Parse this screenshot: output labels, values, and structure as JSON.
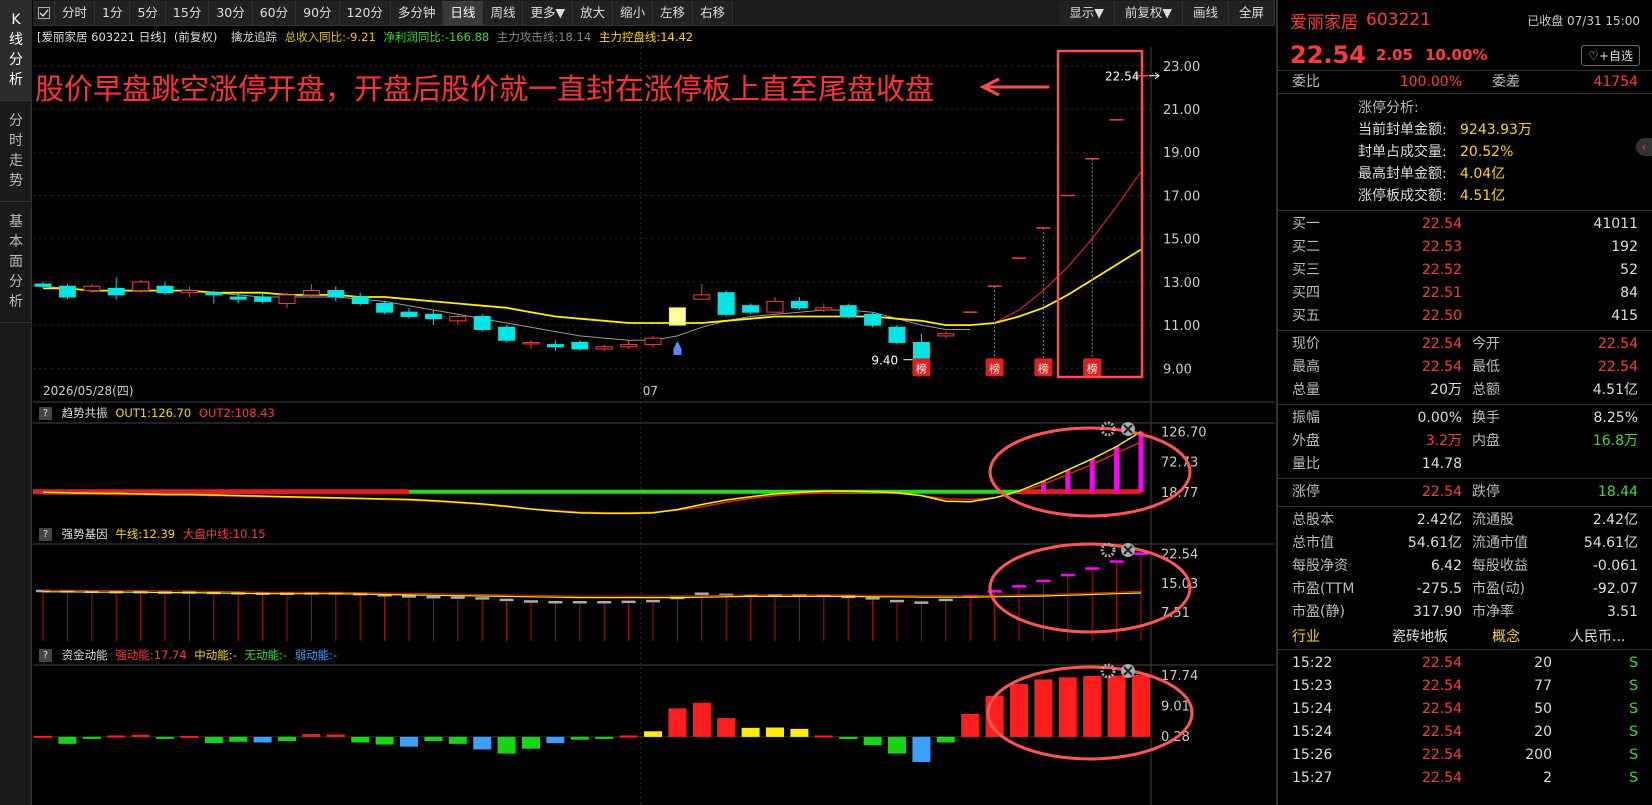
{
  "rail": [
    {
      "chars": [
        "K",
        "线",
        "分",
        "析"
      ],
      "active": true
    },
    {
      "chars": [
        "分",
        "时",
        "走",
        "势"
      ],
      "active": false
    },
    {
      "chars": [
        "基",
        "本",
        "面",
        "分",
        "析"
      ],
      "active": false
    }
  ],
  "toolbar": {
    "periods": [
      "分时",
      "1分",
      "5分",
      "15分",
      "30分",
      "60分",
      "90分",
      "120分",
      "多分钟",
      "日线",
      "周线",
      "更多▼"
    ],
    "active_period": "日线",
    "actions": [
      "放大",
      "缩小",
      "左移",
      "右移"
    ],
    "right": [
      "显示▼",
      "前复权▼",
      "画线",
      "全屏"
    ]
  },
  "main_info": {
    "stock": "[爱丽家居 603221 日线]",
    "adj": "(前复权)",
    "indicator": "擒龙追踪",
    "rev_label": "总收入同比:",
    "rev_value": "-9.21",
    "profit_label": "净利润同比:",
    "profit_value": "-166.88",
    "attack_label": "主力攻击线:",
    "attack_value": "18.14",
    "control_label": "主力控盘线:",
    "control_value": "14.42"
  },
  "annotation": "股价早盘跳空涨停开盘，开盘后股价就一直封在涨停板上直至尾盘收盘",
  "chart_data": [
    {
      "type": "candlestick",
      "date_label": "2026/05/28(四)",
      "mid_label": "07",
      "y_ticks": [
        "23.00",
        "21.00",
        "19.00",
        "17.00",
        "15.00",
        "13.00",
        "11.00",
        "9.00"
      ],
      "ylim": [
        8.6,
        23.5
      ],
      "last_price_label": "22.54",
      "low_label": "9.40",
      "bang_label": "榜",
      "candles": [
        [
          12.9,
          12.8,
          13.0,
          12.7
        ],
        [
          12.8,
          12.3,
          12.9,
          12.2
        ],
        [
          12.6,
          12.8,
          12.9,
          12.5
        ],
        [
          12.7,
          12.4,
          13.2,
          12.2
        ],
        [
          12.6,
          13.0,
          13.1,
          12.5
        ],
        [
          12.8,
          12.5,
          13.0,
          12.4
        ],
        [
          12.5,
          12.6,
          12.8,
          12.3
        ],
        [
          12.5,
          12.4,
          12.6,
          12.0
        ],
        [
          12.3,
          12.2,
          12.5,
          12.0
        ],
        [
          12.3,
          12.1,
          12.5,
          12.0
        ],
        [
          12.0,
          12.4,
          12.5,
          11.8
        ],
        [
          12.4,
          12.6,
          12.9,
          12.3
        ],
        [
          12.6,
          12.3,
          12.8,
          12.1
        ],
        [
          12.3,
          12.0,
          12.5,
          11.9
        ],
        [
          12.0,
          11.6,
          12.1,
          11.5
        ],
        [
          11.6,
          11.4,
          11.8,
          11.3
        ],
        [
          11.5,
          11.3,
          11.7,
          11.0
        ],
        [
          11.2,
          11.4,
          11.5,
          11.0
        ],
        [
          11.4,
          10.8,
          11.5,
          10.7
        ],
        [
          10.9,
          10.3,
          11.0,
          10.2
        ],
        [
          10.2,
          10.2,
          10.3,
          9.9
        ],
        [
          10.1,
          10.0,
          10.3,
          9.8
        ],
        [
          10.2,
          9.9,
          10.3,
          9.8
        ],
        [
          9.9,
          10.0,
          10.1,
          9.8
        ],
        [
          10.0,
          10.1,
          10.3,
          9.9
        ],
        [
          10.1,
          10.4,
          10.5,
          10.0
        ],
        [
          11.0,
          11.8,
          11.8,
          11.0
        ],
        [
          12.2,
          12.4,
          12.9,
          12.2
        ],
        [
          12.5,
          11.5,
          12.6,
          11.4
        ],
        [
          11.9,
          11.6,
          12.0,
          11.5
        ],
        [
          11.6,
          12.1,
          12.3,
          11.6
        ],
        [
          12.1,
          11.8,
          12.3,
          11.7
        ],
        [
          11.7,
          11.8,
          12.0,
          11.6
        ],
        [
          11.9,
          11.4,
          12.0,
          11.3
        ],
        [
          11.5,
          11.0,
          11.6,
          10.9
        ],
        [
          10.9,
          10.2,
          11.0,
          10.1
        ],
        [
          10.2,
          9.4,
          10.6,
          9.4
        ],
        [
          10.5,
          10.6,
          10.7,
          10.4
        ],
        [
          11.6,
          11.6,
          11.6,
          11.6
        ],
        [
          12.8,
          12.8,
          12.8,
          12.8
        ],
        [
          14.1,
          14.1,
          14.1,
          14.1
        ],
        [
          15.5,
          15.5,
          15.5,
          15.5
        ],
        [
          17.0,
          17.0,
          17.0,
          17.0
        ],
        [
          18.7,
          18.7,
          18.7,
          18.7
        ],
        [
          20.5,
          20.5,
          20.5,
          20.5
        ],
        [
          22.54,
          22.54,
          22.54,
          22.54
        ]
      ],
      "ma_yellow": [
        12.7,
        12.7,
        12.6,
        12.6,
        12.6,
        12.6,
        12.6,
        12.5,
        12.5,
        12.5,
        12.4,
        12.4,
        12.4,
        12.3,
        12.3,
        12.2,
        12.1,
        12.0,
        11.9,
        11.8,
        11.6,
        11.4,
        11.3,
        11.2,
        11.1,
        11.1,
        11.1,
        11.1,
        11.2,
        11.3,
        11.4,
        11.4,
        11.4,
        11.4,
        11.4,
        11.3,
        11.2,
        11.0,
        11.0,
        11.1,
        11.4,
        11.8,
        12.4,
        13.1,
        13.8,
        14.5
      ],
      "ma_gray": [
        12.8,
        12.7,
        12.6,
        12.6,
        12.6,
        12.6,
        12.6,
        12.5,
        12.4,
        12.3,
        12.3,
        12.3,
        12.3,
        12.2,
        12.1,
        11.9,
        11.7,
        11.5,
        11.3,
        11.1,
        10.9,
        10.7,
        10.5,
        10.4,
        10.3,
        10.3,
        10.5,
        10.9,
        11.2,
        11.4,
        11.5,
        11.6,
        11.7,
        11.7,
        11.6,
        11.3,
        11.0,
        10.8,
        10.8
      ],
      "ma_red": [
        11.1,
        11.7,
        12.6,
        13.7,
        15.0,
        16.5,
        18.1
      ],
      "bang_indices": [
        36,
        39,
        41,
        43
      ]
    },
    {
      "type": "line",
      "title": "趋势共振",
      "out1_label": "OUT1:",
      "out1_value": "126.70",
      "out2_label": "OUT2:",
      "out2_value": "108.43",
      "y_ticks": [
        "126.70",
        "72.73",
        "18.77"
      ],
      "ylim": [
        -30,
        135
      ],
      "out1": [
        18,
        17,
        16,
        16,
        15,
        14,
        14,
        13,
        12,
        11,
        10,
        9,
        8,
        7,
        6,
        5,
        3,
        0,
        -3,
        -7,
        -12,
        -16,
        -19,
        -20,
        -20,
        -19,
        -13,
        -4,
        4,
        10,
        15,
        18,
        20,
        20,
        19,
        17,
        12,
        2,
        1,
        8,
        20,
        38,
        58,
        78,
        100,
        126.7
      ],
      "out2": [
        15,
        15,
        15,
        14,
        14,
        13,
        13,
        12,
        11,
        10,
        9,
        8,
        7,
        6,
        5,
        4,
        2,
        -1,
        -4,
        -8,
        -12,
        -15,
        -18,
        -19,
        -19,
        -18,
        -14,
        -8,
        0,
        7,
        12,
        15,
        17,
        18,
        18,
        16,
        12,
        6,
        5,
        8,
        18,
        32,
        50,
        68,
        88,
        108.43
      ]
    },
    {
      "type": "bar",
      "title": "强势基因",
      "ox_label": "牛线:",
      "ox_value": "12.39",
      "mid_label": "大盘中线:",
      "mid_value": "10.15",
      "y_ticks": [
        "22.54",
        "15.03",
        "7.51"
      ],
      "ylim": [
        0,
        24
      ],
      "values": [
        12.9,
        12.8,
        12.7,
        12.6,
        12.6,
        12.5,
        12.5,
        12.4,
        12.3,
        12.2,
        12.2,
        12.3,
        12.3,
        12.1,
        11.8,
        11.5,
        11.3,
        11.2,
        11.0,
        10.6,
        10.2,
        10.0,
        10.0,
        10.0,
        10.1,
        10.3,
        11.1,
        12.2,
        11.9,
        11.7,
        11.8,
        11.8,
        11.7,
        11.4,
        11.0,
        10.3,
        9.9,
        10.6,
        11.6,
        12.8,
        14.1,
        15.5,
        17.0,
        18.7,
        20.5,
        22.54
      ],
      "yellow_line": [
        12.7,
        12.7,
        12.6,
        12.6,
        12.6,
        12.5,
        12.5,
        12.4,
        12.3,
        12.2,
        12.2,
        12.2,
        12.2,
        12.1,
        12.0,
        11.9,
        11.8,
        11.7,
        11.6,
        11.5,
        11.4,
        11.3,
        11.2,
        11.2,
        11.2,
        11.2,
        11.2,
        11.3,
        11.4,
        11.5,
        11.5,
        11.5,
        11.5,
        11.5,
        11.4,
        11.4,
        11.3,
        11.3,
        11.3,
        11.4,
        11.5,
        11.6,
        11.8,
        12.0,
        12.2,
        12.39
      ]
    },
    {
      "type": "bar",
      "title": "资金动能",
      "strong_label": "强动能:",
      "strong_value": "17.74",
      "mid_label": "中动能:",
      "mid_value": "-",
      "none_label": "无动能:",
      "none_value": "-",
      "weak_label": "弱动能:",
      "weak_value": "-",
      "y_ticks": [
        "17.74",
        "9.01",
        "0.28"
      ],
      "ylim": [
        -7.5,
        19.5
      ],
      "values": [
        0.3,
        -2.0,
        -0.4,
        0.4,
        0.6,
        -0.5,
        0.3,
        -1.8,
        -1.4,
        -1.6,
        -1.2,
        0.8,
        0.7,
        -1.6,
        -2.2,
        -2.8,
        -1.2,
        -2.0,
        -3.6,
        -4.8,
        -3.4,
        -1.8,
        -0.8,
        -0.5,
        0.4,
        1.6,
        8.2,
        9.8,
        5.4,
        2.6,
        2.7,
        2.3,
        0.4,
        -0.6,
        -2.4,
        -4.8,
        -7.2,
        -1.6,
        6.6,
        11.8,
        15.2,
        16.5,
        17.1,
        17.5,
        17.6,
        17.74
      ],
      "colors": [
        "#ff1e1e",
        "#16d416",
        "#3ba0ff",
        "#ffee00"
      ]
    }
  ],
  "quote": {
    "name": "爱丽家居",
    "code": "603221",
    "status": "已收盘 07/31 15:00",
    "price": "22.54",
    "change": "2.05",
    "change_pct": "10.00%",
    "watch_btn": "+自选",
    "weibi_label": "委比",
    "weibi": "100.00%",
    "weicha_label": "委差",
    "weicha": "41754",
    "limit_title": "涨停分析:",
    "limit_rows": [
      {
        "k": "当前封单金额:",
        "v": "9243.93万"
      },
      {
        "k": "封单占成交量:",
        "v": "20.52%"
      },
      {
        "k": "最高封单金额:",
        "v": "4.04亿"
      },
      {
        "k": "涨停板成交额:",
        "v": "4.51亿"
      }
    ],
    "bids": [
      {
        "k": "买一",
        "p": "22.54",
        "v": "41011"
      },
      {
        "k": "买二",
        "p": "22.53",
        "v": "192"
      },
      {
        "k": "买三",
        "p": "22.52",
        "v": "52"
      },
      {
        "k": "买四",
        "p": "22.51",
        "v": "84"
      },
      {
        "k": "买五",
        "p": "22.50",
        "v": "415"
      }
    ],
    "stats": [
      {
        "k1": "现价",
        "v1": "22.54",
        "c1": "red",
        "k2": "今开",
        "v2": "22.54",
        "c2": "red"
      },
      {
        "k1": "最高",
        "v1": "22.54",
        "c1": "red",
        "k2": "最低",
        "v2": "22.54",
        "c2": "red"
      },
      {
        "k1": "总量",
        "v1": "20万",
        "c1": "white",
        "k2": "总额",
        "v2": "4.51亿",
        "c2": "white"
      }
    ],
    "stats2": [
      {
        "k1": "振幅",
        "v1": "0.00%",
        "c1": "white",
        "k2": "换手",
        "v2": "8.25%",
        "c2": "white"
      },
      {
        "k1": "外盘",
        "v1": "3.2万",
        "c1": "red",
        "k2": "内盘",
        "v2": "16.8万",
        "c2": "green"
      },
      {
        "k1": "量比",
        "v1": "14.78",
        "c1": "white",
        "k2": "",
        "v2": "",
        "c2": "white"
      }
    ],
    "stats3": [
      {
        "k1": "涨停",
        "v1": "22.54",
        "c1": "red",
        "k2": "跌停",
        "v2": "18.44",
        "c2": "green"
      }
    ],
    "stats4": [
      {
        "k1": "总股本",
        "v1": "2.42亿",
        "k2": "流通股",
        "v2": "2.42亿"
      },
      {
        "k1": "总市值",
        "v1": "54.61亿",
        "k2": "流通市值",
        "v2": "54.61亿"
      },
      {
        "k1": "每股净资",
        "v1": "6.42",
        "k2": "每股收益",
        "v2": "-0.061"
      },
      {
        "k1": "市盈(TTM",
        "v1": "-275.5",
        "k2": "市盈(动)",
        "v2": "-92.07"
      },
      {
        "k1": "市盈(静)",
        "v1": "317.90",
        "k2": "市净率",
        "v2": "3.51"
      }
    ],
    "industry_label": "行业",
    "industry": "瓷砖地板",
    "concept_label": "概念",
    "concept": "人民币...",
    "ticks": [
      {
        "t": "15:22",
        "p": "22.54",
        "v": "20",
        "s": "S"
      },
      {
        "t": "15:23",
        "p": "22.54",
        "v": "77",
        "s": "S"
      },
      {
        "t": "15:24",
        "p": "22.54",
        "v": "50",
        "s": "S"
      },
      {
        "t": "15:24",
        "p": "22.54",
        "v": "20",
        "s": "S"
      },
      {
        "t": "15:26",
        "p": "22.54",
        "v": "200",
        "s": "S"
      },
      {
        "t": "15:27",
        "p": "22.54",
        "v": "2",
        "s": "S"
      }
    ]
  }
}
